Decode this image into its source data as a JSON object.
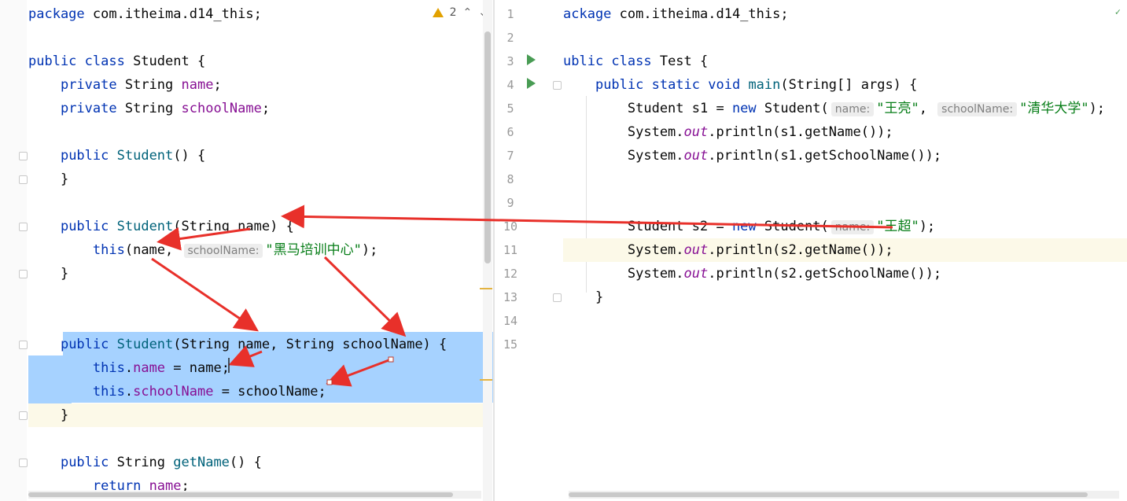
{
  "left_editor": {
    "warning_count": "2",
    "lines": [
      [
        {
          "t": "package",
          "c": "kw"
        },
        {
          "t": " com.itheima.d14_this;"
        }
      ],
      [],
      [
        {
          "t": "public class",
          "c": "kw"
        },
        {
          "t": " Student {"
        }
      ],
      [
        {
          "t": "    "
        },
        {
          "t": "private",
          "c": "kw"
        },
        {
          "t": " String "
        },
        {
          "t": "name",
          "c": "fld"
        },
        {
          "t": ";"
        }
      ],
      [
        {
          "t": "    "
        },
        {
          "t": "private",
          "c": "kw"
        },
        {
          "t": " String "
        },
        {
          "t": "schoolName",
          "c": "fld"
        },
        {
          "t": ";"
        }
      ],
      [],
      [
        {
          "t": "    "
        },
        {
          "t": "public",
          "c": "kw"
        },
        {
          "t": " "
        },
        {
          "t": "Student",
          "c": "fn"
        },
        {
          "t": "() {"
        }
      ],
      [
        {
          "t": "    }"
        }
      ],
      [],
      [
        {
          "t": "    "
        },
        {
          "t": "public",
          "c": "kw"
        },
        {
          "t": " "
        },
        {
          "t": "Student",
          "c": "fn"
        },
        {
          "t": "(String name) {"
        }
      ],
      [
        {
          "t": "        "
        },
        {
          "t": "this",
          "c": "kw"
        },
        {
          "t": "(name, "
        },
        {
          "t": "schoolName:",
          "c": "hint"
        },
        {
          "t": "\"黑马培训中心\"",
          "c": "str"
        },
        {
          "t": ");"
        }
      ],
      [
        {
          "t": "    }"
        }
      ],
      [],
      [],
      [
        {
          "t": "    "
        },
        {
          "t": "public",
          "c": "kw"
        },
        {
          "t": " "
        },
        {
          "t": "Student",
          "c": "fn"
        },
        {
          "t": "(String name, String schoolName) {"
        }
      ],
      [
        {
          "t": "        "
        },
        {
          "t": "this",
          "c": "kw"
        },
        {
          "t": "."
        },
        {
          "t": "name",
          "c": "fld"
        },
        {
          "t": " = name;"
        }
      ],
      [
        {
          "t": "        "
        },
        {
          "t": "this",
          "c": "kw"
        },
        {
          "t": "."
        },
        {
          "t": "schoolName",
          "c": "fld"
        },
        {
          "t": " = schoolName;"
        }
      ],
      [
        {
          "t": "    }"
        }
      ],
      [],
      [
        {
          "t": "    "
        },
        {
          "t": "public",
          "c": "kw"
        },
        {
          "t": " String "
        },
        {
          "t": "getName",
          "c": "fn"
        },
        {
          "t": "() {"
        }
      ],
      [
        {
          "t": "        "
        },
        {
          "t": "return",
          "c": "kw"
        },
        {
          "t": " "
        },
        {
          "t": "name",
          "c": "fld"
        },
        {
          "t": ";"
        }
      ]
    ]
  },
  "right_editor": {
    "line_numbers": [
      "1",
      "2",
      "3",
      "4",
      "5",
      "6",
      "7",
      "8",
      "9",
      "10",
      "11",
      "12",
      "13",
      "14",
      "15"
    ],
    "lines": [
      [
        {
          "t": "ackage",
          "c": "kw"
        },
        {
          "t": " com.itheima.d14_this;"
        }
      ],
      [],
      [
        {
          "t": "ublic class",
          "c": "kw"
        },
        {
          "t": " Test {"
        }
      ],
      [
        {
          "t": "    "
        },
        {
          "t": "public static void",
          "c": "kw"
        },
        {
          "t": " "
        },
        {
          "t": "main",
          "c": "fn"
        },
        {
          "t": "(String[] args) {"
        }
      ],
      [
        {
          "t": "        Student s1 = "
        },
        {
          "t": "new",
          "c": "kw"
        },
        {
          "t": " Student("
        },
        {
          "t": "name:",
          "c": "hint"
        },
        {
          "t": "\"王亮\"",
          "c": "str"
        },
        {
          "t": ", "
        },
        {
          "t": "schoolName:",
          "c": "hint"
        },
        {
          "t": "\"清华大学\"",
          "c": "str"
        },
        {
          "t": ");"
        }
      ],
      [
        {
          "t": "        System."
        },
        {
          "t": "out",
          "c": "italic-fld"
        },
        {
          "t": ".println(s1.getName());"
        }
      ],
      [
        {
          "t": "        System."
        },
        {
          "t": "out",
          "c": "italic-fld"
        },
        {
          "t": ".println(s1.getSchoolName());"
        }
      ],
      [],
      [],
      [
        {
          "t": "        Student s2 = "
        },
        {
          "t": "new",
          "c": "kw"
        },
        {
          "t": " Student("
        },
        {
          "t": "name:",
          "c": "hint"
        },
        {
          "t": "\"王超\"",
          "c": "str"
        },
        {
          "t": ");"
        }
      ],
      [
        {
          "t": "        System."
        },
        {
          "t": "out",
          "c": "italic-fld"
        },
        {
          "t": ".println(s2.getName());"
        }
      ],
      [
        {
          "t": "        System."
        },
        {
          "t": "out",
          "c": "italic-fld"
        },
        {
          "t": ".println(s2.getSchoolName());"
        }
      ],
      [
        {
          "t": "    }"
        }
      ],
      [],
      []
    ]
  },
  "colors": {
    "keyword": "#0033b3",
    "field": "#871094",
    "method": "#00627a",
    "string": "#067d17",
    "selection": "#a6d2ff",
    "arrow": "#e8302a",
    "run": "#499c54"
  }
}
